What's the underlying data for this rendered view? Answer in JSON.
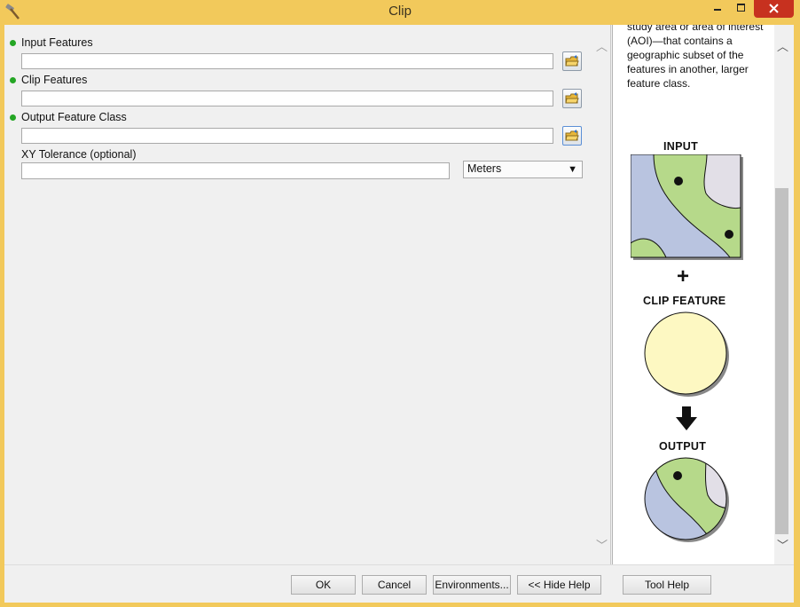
{
  "window": {
    "title": "Clip",
    "colors": {
      "frame": "#f2c95b",
      "close": "#c7311f",
      "required_dot": "#24a624"
    },
    "icons": {
      "app": "hammer-icon",
      "minimize": "minimize-icon",
      "maximize": "maximize-icon",
      "close": "close-icon"
    }
  },
  "params": [
    {
      "label": "Input Features",
      "required": true,
      "value": ""
    },
    {
      "label": "Clip Features",
      "required": true,
      "value": ""
    },
    {
      "label": "Output Feature Class",
      "required": true,
      "value": ""
    },
    {
      "label": "XY Tolerance (optional)",
      "required": false,
      "value": ""
    }
  ],
  "units": {
    "selected": "Meters"
  },
  "help": {
    "text": "study area or area of interest (AOI)—that contains a geographic subset of the features in another, larger feature class.",
    "diagram": {
      "input_label": "INPUT",
      "clip_label": "CLIP FEATURE",
      "output_label": "OUTPUT",
      "plus_glyph": "+"
    }
  },
  "buttons": {
    "ok": "OK",
    "cancel": "Cancel",
    "environments": "Environments...",
    "hide_help": "<< Hide Help",
    "tool_help": "Tool Help"
  }
}
